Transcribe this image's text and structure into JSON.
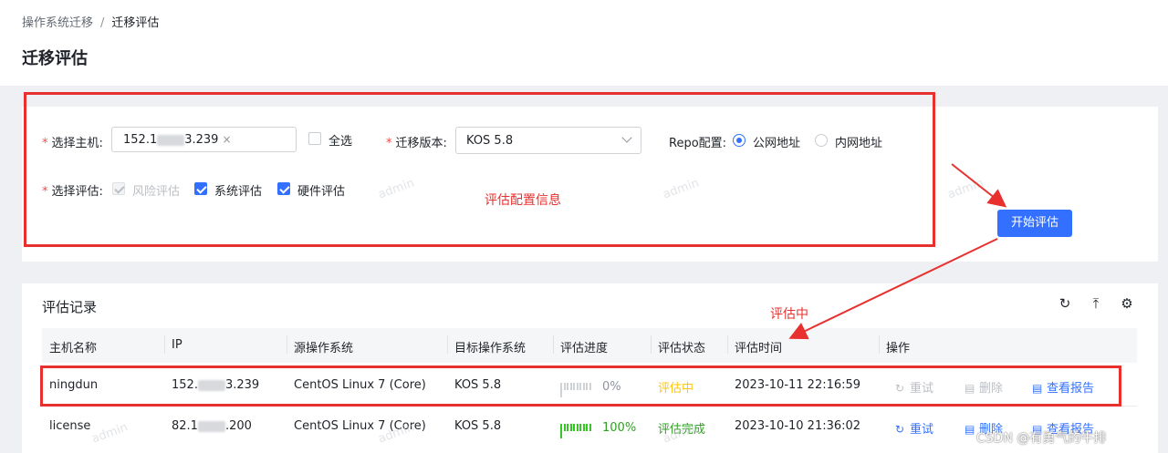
{
  "breadcrumb": {
    "parent": "操作系统迁移",
    "separator": "/",
    "current": "迁移评估"
  },
  "page_title": "迁移评估",
  "config": {
    "host_label": "选择主机:",
    "host_tag_prefix": "152.1",
    "host_tag_suffix": "3.239",
    "select_all_label": "全选",
    "version_label": "迁移版本:",
    "version_value": "KOS 5.8",
    "repo_label": "Repo配置:",
    "repo_options": [
      "公网地址",
      "内网地址"
    ],
    "repo_selected": "公网地址",
    "eval_label": "选择评估:",
    "eval_options": [
      {
        "label": "风险评估",
        "checked": true,
        "disabled": true
      },
      {
        "label": "系统评估",
        "checked": true,
        "disabled": false
      },
      {
        "label": "硬件评估",
        "checked": true,
        "disabled": false
      }
    ],
    "start_button": "开始评估"
  },
  "annotations": {
    "config_info": "评估配置信息",
    "evaluating": "评估中"
  },
  "records": {
    "title": "评估记录",
    "toolbar_icons": [
      "refresh-icon",
      "export-icon",
      "settings-icon"
    ],
    "columns": [
      "主机名称",
      "IP",
      "源操作系统",
      "目标操作系统",
      "评估进度",
      "评估状态",
      "评估时间",
      "操作"
    ],
    "rows": [
      {
        "host": "ningdun",
        "ip_prefix": "152.",
        "ip_suffix": "3.239",
        "source_os": "CentOS Linux 7 (Core)",
        "target_os": "KOS 5.8",
        "progress": 0,
        "progress_text": "0%",
        "status": "评估中",
        "time": "2023-10-11 22:16:59",
        "actions": {
          "retry": "重试",
          "delete": "删除",
          "report": "查看报告"
        }
      },
      {
        "host": "license",
        "ip_prefix": "82.1",
        "ip_suffix": ".200",
        "source_os": "CentOS Linux 7 (Core)",
        "target_os": "KOS 5.8",
        "progress": 100,
        "progress_text": "100%",
        "status": "评估完成",
        "time": "2023-10-10 21:36:02",
        "actions": {
          "retry": "重试",
          "delete": "删除",
          "report": "查看报告"
        }
      }
    ]
  },
  "watermark": "admin",
  "credit": "CSDN @有勇气的牛排",
  "colors": {
    "primary": "#3370ff",
    "annotation_red": "#e8312f",
    "running": "#ffc60a",
    "done": "#2ea121"
  }
}
